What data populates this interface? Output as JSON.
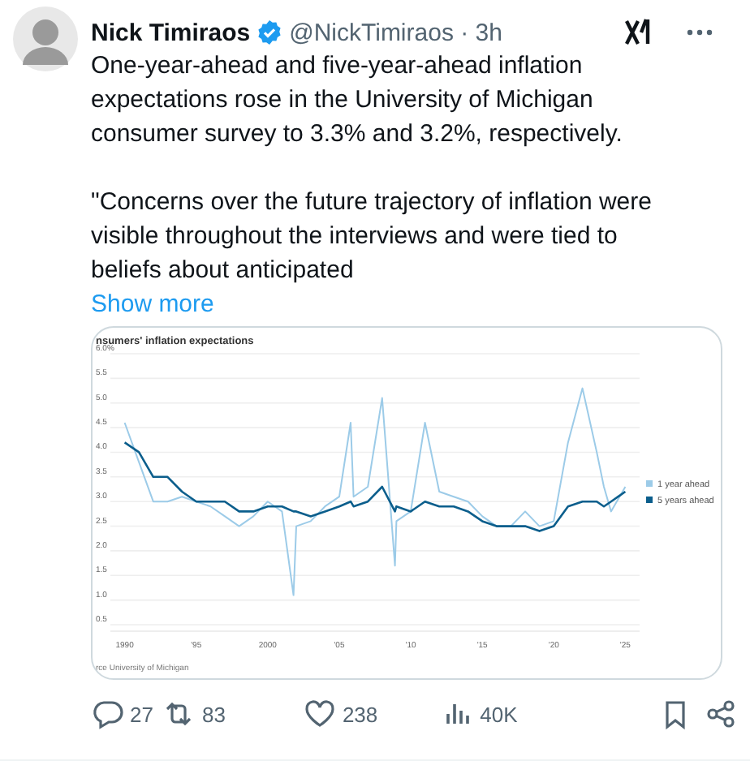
{
  "tweet": {
    "author": {
      "name": "Nick Timiraos",
      "verified": true,
      "meta": "@NickTimiraos · 3h"
    },
    "paragraphs": [
      "One-year-ahead and five-year-ahead inflation expectations rose in the University of Michigan consumer survey to 3.3% and 3.2%, respectively.",
      "\"Concerns over the future trajectory of inflation were visible throughout the interviews and were tied to beliefs about anticipated"
    ],
    "show_more": "Show more",
    "media": {
      "source": "rce University of Michigan",
      "chart_data": {
        "type": "line",
        "title": "nsumers' inflation expectations",
        "x": [
          1990,
          1991,
          1992,
          1993,
          1994,
          1995,
          1996,
          1997,
          1998,
          1999,
          2000,
          2001,
          2001.8,
          2002,
          2003,
          2004,
          2005,
          2005.8,
          2006,
          2007,
          2008,
          2008.9,
          2009,
          2010,
          2011,
          2012,
          2013,
          2014,
          2015,
          2016,
          2017,
          2018,
          2019,
          2020,
          2021,
          2022,
          2023,
          2023.5,
          2024,
          2025
        ],
        "series": [
          {
            "name": "1 year ahead",
            "color": "#9ccbe8",
            "values": [
              4.6,
              3.8,
              3.0,
              3.0,
              3.1,
              3.0,
              2.9,
              2.7,
              2.5,
              2.7,
              3.0,
              2.8,
              1.1,
              2.5,
              2.6,
              2.9,
              3.1,
              4.6,
              3.1,
              3.3,
              5.1,
              1.7,
              2.6,
              2.8,
              4.6,
              3.2,
              3.1,
              3.0,
              2.7,
              2.5,
              2.5,
              2.8,
              2.5,
              2.6,
              4.2,
              5.3,
              4.0,
              3.3,
              2.8,
              3.3
            ]
          },
          {
            "name": "5 years ahead",
            "color": "#0b5e8c",
            "values": [
              4.2,
              4.0,
              3.5,
              3.5,
              3.2,
              3.0,
              3.0,
              3.0,
              2.8,
              2.8,
              2.9,
              2.9,
              2.8,
              2.8,
              2.7,
              2.8,
              2.9,
              3.0,
              2.9,
              3.0,
              3.3,
              2.8,
              2.9,
              2.8,
              3.0,
              2.9,
              2.9,
              2.8,
              2.6,
              2.5,
              2.5,
              2.5,
              2.4,
              2.5,
              2.9,
              3.0,
              3.0,
              2.9,
              3.0,
              3.2
            ]
          }
        ],
        "xlim": [
          1989,
          2026
        ],
        "ylim": [
          0.5,
          6.0
        ],
        "xticks": [
          {
            "value": 1990,
            "label": "1990"
          },
          {
            "value": 1995,
            "label": "'95"
          },
          {
            "value": 2000,
            "label": "2000"
          },
          {
            "value": 2005,
            "label": "'05"
          },
          {
            "value": 2010,
            "label": "'10"
          },
          {
            "value": 2015,
            "label": "'15"
          },
          {
            "value": 2020,
            "label": "'20"
          },
          {
            "value": 2025,
            "label": "'25"
          }
        ],
        "yticks": [
          {
            "value": 0.5,
            "label": "0.5"
          },
          {
            "value": 1,
            "label": "1.0"
          },
          {
            "value": 1.5,
            "label": "1.5"
          },
          {
            "value": 2,
            "label": "2.0"
          },
          {
            "value": 2.5,
            "label": "2.5"
          },
          {
            "value": 3,
            "label": "3.0"
          },
          {
            "value": 3.5,
            "label": "3.5"
          },
          {
            "value": 4,
            "label": "4.0"
          },
          {
            "value": 4.5,
            "label": "4.5"
          },
          {
            "value": 5,
            "label": "5.0"
          },
          {
            "value": 5.5,
            "label": "5.5"
          },
          {
            "value": 6,
            "label": "6.0%"
          }
        ],
        "grid": true,
        "legend": true
      }
    },
    "actions": [
      {
        "kind": "reply",
        "count": "27"
      },
      {
        "kind": "repost",
        "count": "83"
      },
      {
        "kind": "like",
        "count": "238"
      },
      {
        "kind": "views",
        "count": "40K"
      },
      {
        "kind": "bookmark"
      },
      {
        "kind": "share"
      }
    ]
  }
}
